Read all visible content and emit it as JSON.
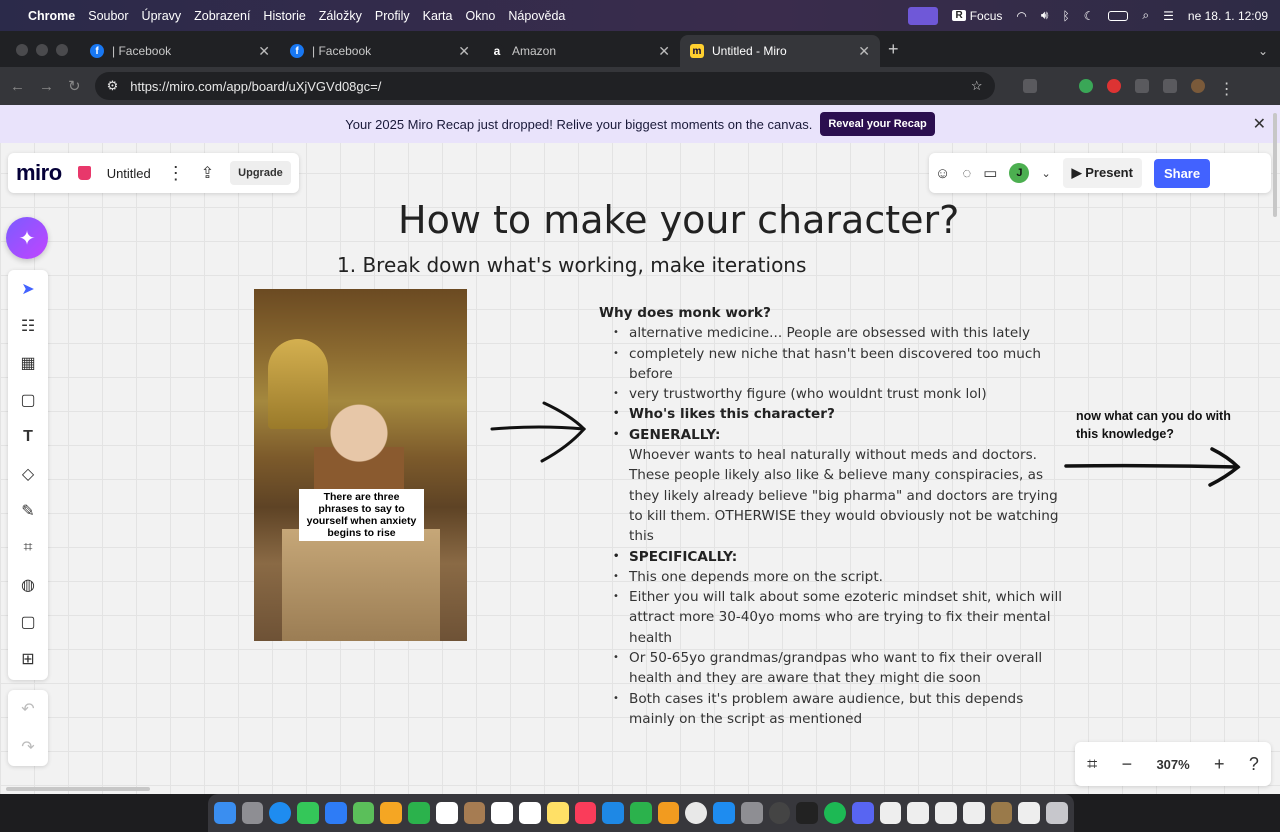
{
  "menubar": {
    "app": "Chrome",
    "items": [
      "Soubor",
      "Úpravy",
      "Zobrazení",
      "Historie",
      "Záložky",
      "Profily",
      "Karta",
      "Okno",
      "Nápověda"
    ],
    "focus_label": "Focus",
    "datetime": "ne 18. 1. 12:09"
  },
  "tabs": [
    {
      "label": "| Facebook",
      "icon": "facebook-icon"
    },
    {
      "label": "| Facebook",
      "icon": "facebook-icon"
    },
    {
      "label": "Amazon",
      "icon": "amazon-icon"
    },
    {
      "label": "Untitled - Miro",
      "icon": "miro-icon"
    }
  ],
  "address": {
    "url": "https://miro.com/app/board/uXjVGVd08gc=/"
  },
  "banner": {
    "text": "Your 2025 Miro Recap just dropped! Relive your biggest moments on the canvas.",
    "button": "Reveal your Recap"
  },
  "board": {
    "logo": "miro",
    "title": "Untitled",
    "upgrade": "Upgrade",
    "present": "Present",
    "share": "Share",
    "avatar_initial": "J",
    "zoom": "307%"
  },
  "content": {
    "title": "How to make your character?",
    "subtitle": "1. Break down what's working, make iterations",
    "photo_caption": "There are three phrases to say to yourself when anxiety begins to rise",
    "side_question": "now what can you do with this knowledge?",
    "notes_heading": "Why does monk work?",
    "notes": [
      {
        "text": "alternative medicine... People are obsessed with this lately",
        "bold": false
      },
      {
        "text": "completely new niche that hasn't been discovered too much before",
        "bold": false
      },
      {
        "text": "very trustworthy figure (who wouldnt trust monk lol)",
        "bold": false
      },
      {
        "text": "Who's likes this character?",
        "bold": true
      },
      {
        "text": "GENERALLY:",
        "bold": true
      },
      {
        "text": "Whoever wants to heal naturally without meds and doctors. These people likely also like & believe many conspiracies, as they likely already believe \"big pharma\" and doctors are trying to kill them. OTHERWISE they would obviously not be watching this",
        "bold": false,
        "no_bullet": true
      },
      {
        "text": "SPECIFICALLY:",
        "bold": true
      },
      {
        "text": "This one depends more on the script.",
        "bold": false
      },
      {
        "text": "Either you will talk about some ezoteric mindset shit, which will attract more 30-40yo moms who are trying to fix their mental health",
        "bold": false
      },
      {
        "text": "Or 50-65yo grandmas/grandpas who want to fix their overall health and they are aware that they might die soon",
        "bold": false
      },
      {
        "text": "Both cases it's problem aware audience, but this depends mainly on the script as mentioned",
        "bold": false
      }
    ]
  },
  "colors": {
    "accent": "#4262ff",
    "banner_bg": "#e9e3fb",
    "reveal_bg": "#2b0f4f"
  }
}
